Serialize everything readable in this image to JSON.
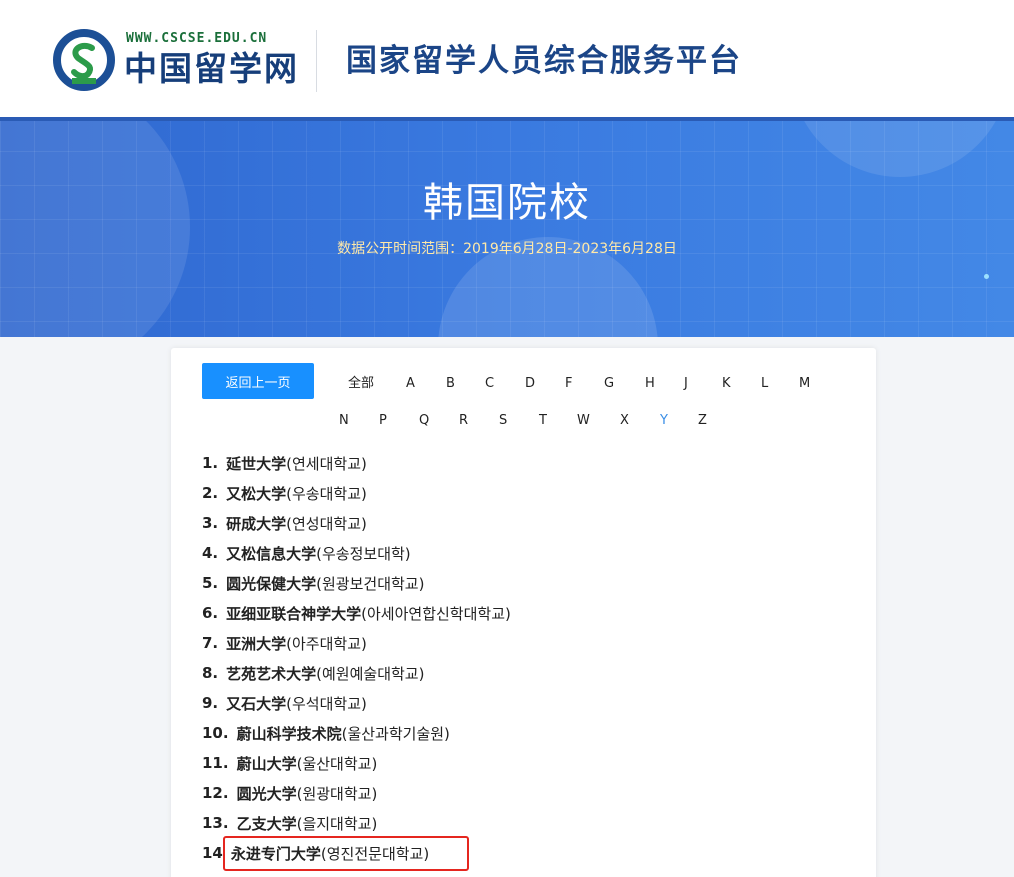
{
  "header": {
    "logo_url": "WWW.CSCSE.EDU.CN",
    "logo_name": "中国留学网",
    "platform_title": "国家留学人员综合服务平台"
  },
  "banner": {
    "title": "韩国院校",
    "subtitle": "数据公开时间范围：2019年6月28日-2023年6月28日"
  },
  "nav": {
    "back_label": "返回上一页",
    "letters_row1": [
      "全部",
      "A",
      "B",
      "C",
      "D",
      "F",
      "G",
      "H",
      "J",
      "K",
      "L",
      "M"
    ],
    "letters_row2": [
      "N",
      "P",
      "Q",
      "R",
      "S",
      "T",
      "W",
      "X",
      "Y",
      "Z"
    ],
    "active_letter": "Y"
  },
  "schools": [
    {
      "num": "1.",
      "cn": "延世大学",
      "kr": "(연세대학교)"
    },
    {
      "num": "2.",
      "cn": "又松大学",
      "kr": "(우송대학교)"
    },
    {
      "num": "3.",
      "cn": "研成大学",
      "kr": "(연성대학교)"
    },
    {
      "num": "4.",
      "cn": "又松信息大学",
      "kr": "(우송정보대학)"
    },
    {
      "num": "5.",
      "cn": "圆光保健大学",
      "kr": "(원광보건대학교)"
    },
    {
      "num": "6.",
      "cn": "亚细亚联合神学大学",
      "kr": "(아세아연합신학대학교)"
    },
    {
      "num": "7.",
      "cn": "亚洲大学",
      "kr": "(아주대학교)"
    },
    {
      "num": "8.",
      "cn": "艺苑艺术大学",
      "kr": "(예원예술대학교)"
    },
    {
      "num": "9.",
      "cn": "又石大学",
      "kr": "(우석대학교)"
    },
    {
      "num": "10.",
      "cn": "蔚山科学技术院",
      "kr": "(울산과학기술원)"
    },
    {
      "num": "11.",
      "cn": "蔚山大学",
      "kr": "(울산대학교)"
    },
    {
      "num": "12.",
      "cn": "圆光大学",
      "kr": "(원광대학교)"
    },
    {
      "num": "13.",
      "cn": "乙支大学",
      "kr": "(을지대학교)"
    },
    {
      "num": "14",
      "cn": "永进专门大学",
      "kr": "(영진전문대학교)"
    }
  ],
  "colors": {
    "accent": "#1890ff",
    "active_letter": "#3a8ee6",
    "highlight": "#e5261f",
    "banner": "#3a7ae0"
  }
}
